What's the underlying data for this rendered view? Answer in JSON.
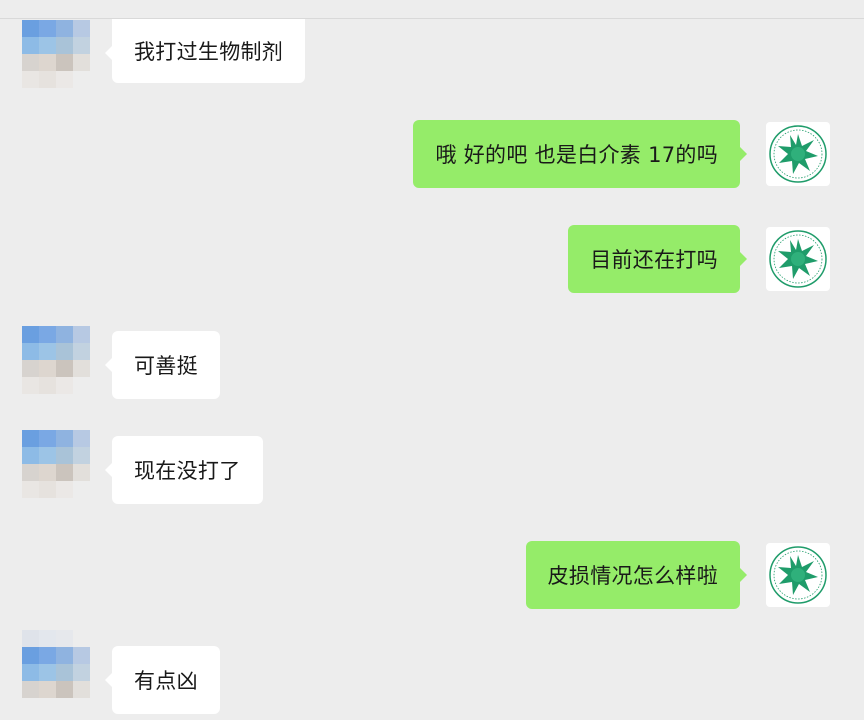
{
  "chat": {
    "messages": [
      {
        "side": "incoming",
        "text": "我打过生物制剂"
      },
      {
        "side": "outgoing",
        "text": "哦 好的吧 也是白介素 17的吗"
      },
      {
        "side": "outgoing",
        "text": "目前还在打吗"
      },
      {
        "side": "incoming",
        "text": "可善挺"
      },
      {
        "side": "incoming",
        "text": "现在没打了"
      },
      {
        "side": "outgoing",
        "text": "皮损情况怎么样啦"
      },
      {
        "side": "incoming",
        "text": "有点凶"
      }
    ]
  },
  "colors": {
    "background": "#ededed",
    "incoming_bubble": "#ffffff",
    "outgoing_bubble": "#95ec69",
    "text": "#191919",
    "emblem_green": "#1f9c6a"
  },
  "avatars": {
    "incoming": "pixelated-avatar",
    "outgoing": "green-star-emblem-avatar"
  }
}
